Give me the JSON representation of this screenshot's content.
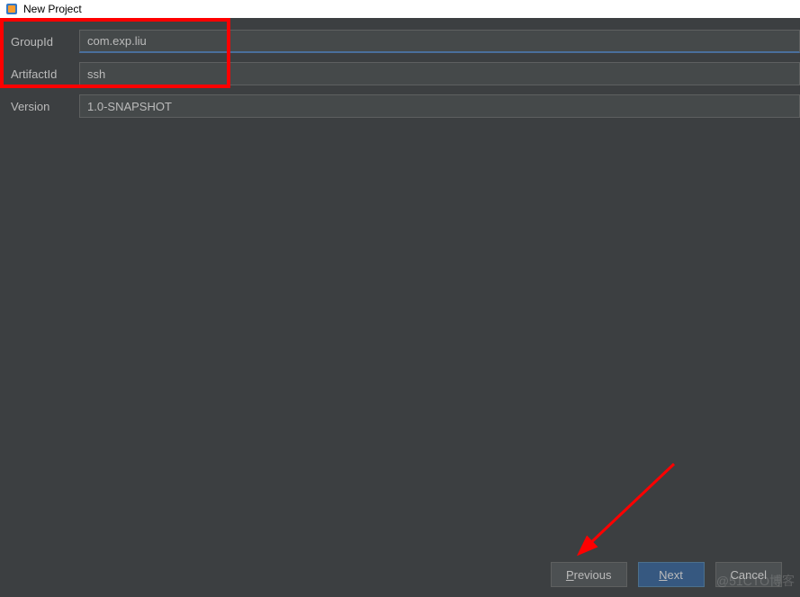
{
  "window": {
    "title": "New Project"
  },
  "form": {
    "group_id": {
      "label": "GroupId",
      "value": "com.exp.liu"
    },
    "artifact_id": {
      "label": "ArtifactId",
      "value": "ssh"
    },
    "version": {
      "label": "Version",
      "value": "1.0-SNAPSHOT"
    }
  },
  "buttons": {
    "previous": "Previous",
    "next": "Next",
    "cancel": "Cancel"
  },
  "watermark": "@51CTO博客"
}
